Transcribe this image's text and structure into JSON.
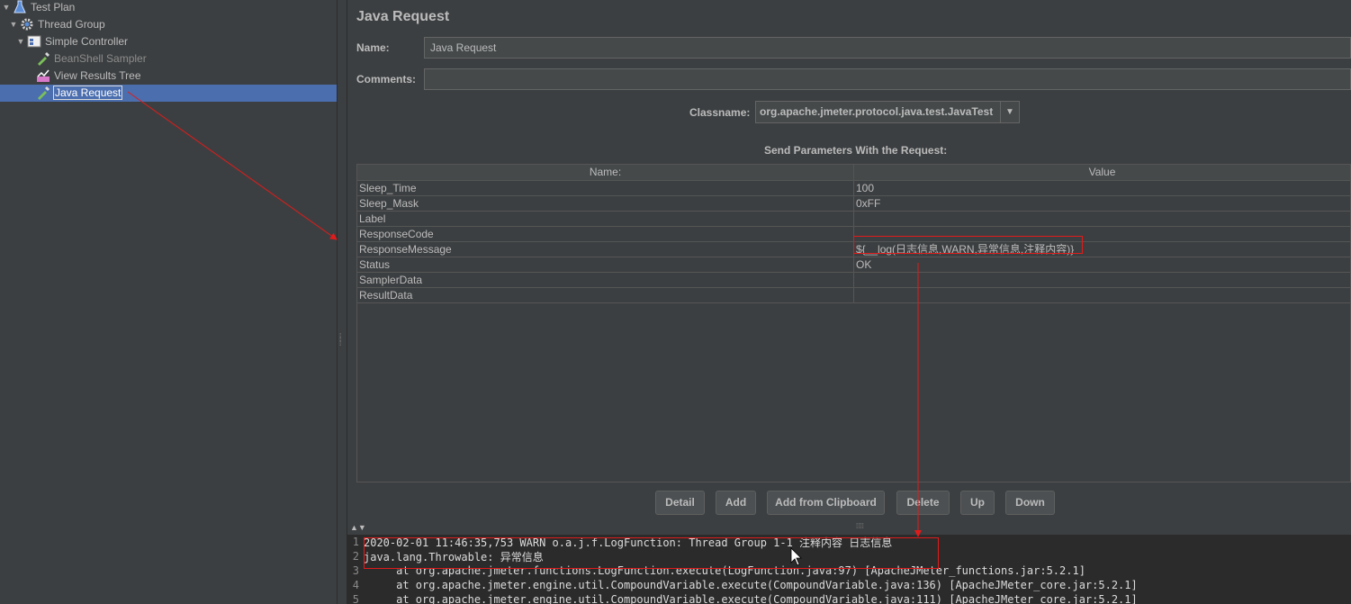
{
  "tree": {
    "items": [
      {
        "label": "Test Plan",
        "icon": "flask-icon"
      },
      {
        "label": "Thread Group",
        "icon": "gear-icon"
      },
      {
        "label": "Simple Controller",
        "icon": "controller-icon"
      },
      {
        "label": "BeanShell Sampler",
        "icon": "pipette-icon"
      },
      {
        "label": "View Results Tree",
        "icon": "chart-icon"
      },
      {
        "label": "Java Request",
        "icon": "pipette-icon"
      }
    ]
  },
  "panel": {
    "title": "Java Request",
    "name_label": "Name:",
    "name_value": "Java Request",
    "comments_label": "Comments:",
    "comments_value": "",
    "classname_label": "Classname:",
    "classname_value": "org.apache.jmeter.protocol.java.test.JavaTest",
    "classname_arrow": "▼",
    "params_title": "Send Parameters With the Request:"
  },
  "table": {
    "headers": [
      "Name:",
      "Value"
    ],
    "rows": [
      {
        "name": "Sleep_Time",
        "value": "100"
      },
      {
        "name": "Sleep_Mask",
        "value": "0xFF"
      },
      {
        "name": "Label",
        "value": ""
      },
      {
        "name": "ResponseCode",
        "value": ""
      },
      {
        "name": "ResponseMessage",
        "value": "${__log(日志信息,WARN,异常信息,注释内容)}"
      },
      {
        "name": "Status",
        "value": "OK"
      },
      {
        "name": "SamplerData",
        "value": ""
      },
      {
        "name": "ResultData",
        "value": ""
      }
    ]
  },
  "buttons": {
    "detail": "Detail",
    "add": "Add",
    "add_clipboard": "Add from Clipboard",
    "delete": "Delete",
    "up": "Up",
    "down": "Down"
  },
  "log": {
    "lines": [
      {
        "num": "1",
        "text": "2020-02-01 11:46:35,753 WARN o.a.j.f.LogFunction: Thread Group 1-1 注释内容 日志信息"
      },
      {
        "num": "2",
        "text": "java.lang.Throwable: 异常信息"
      },
      {
        "num": "3",
        "text": "     at org.apache.jmeter.functions.LogFunction.execute(LogFunction.java:97) [ApacheJMeter_functions.jar:5.2.1]"
      },
      {
        "num": "4",
        "text": "     at org.apache.jmeter.engine.util.CompoundVariable.execute(CompoundVariable.java:136) [ApacheJMeter_core.jar:5.2.1]"
      },
      {
        "num": "5",
        "text": "     at org.apache.jmeter.engine.util.CompoundVariable.execute(CompoundVariable.java:111) [ApacheJMeter_core.jar:5.2.1]"
      }
    ]
  },
  "colors": {
    "background": "#3c3f41",
    "selection": "#4b6eaf",
    "annotation": "#e01b1b",
    "log_background": "#2b2b2b"
  }
}
